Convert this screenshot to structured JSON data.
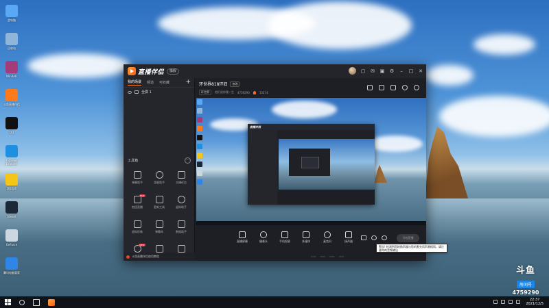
{
  "desktop": {
    "icons": [
      {
        "label": "此电脑",
        "icon": "computer-icon",
        "color": "#5aa7f5"
      },
      {
        "label": "回收站",
        "icon": "recycle-bin-icon",
        "color": "#8fb6d9"
      },
      {
        "label": "WinRAR",
        "icon": "winrar-icon",
        "color": "#a23c7a"
      },
      {
        "label": "斗鱼直播伴侣",
        "icon": "douyu-icon",
        "color": "#ff7a1a"
      },
      {
        "label": "QQ",
        "icon": "qq-icon",
        "color": "#111111"
      },
      {
        "label": "Internet Explorer",
        "icon": "ie-icon",
        "color": "#1f8fe0"
      },
      {
        "label": "QQ游戏",
        "icon": "qq-game-icon",
        "color": "#f5c518"
      },
      {
        "label": "Steam",
        "icon": "steam-icon",
        "color": "#1b2838"
      },
      {
        "label": "GeForce",
        "icon": "settings-icon",
        "color": "#ccd7e0"
      },
      {
        "label": "腾讯电脑管家",
        "icon": "shield-icon",
        "color": "#2f86e6"
      }
    ]
  },
  "app": {
    "brand": "直播伴侣",
    "tag": "旗舰",
    "title_buttons": [
      "record-icon",
      "message-icon",
      "gift-icon",
      "settings-icon",
      "minimize-icon",
      "maximize-icon",
      "close-icon"
    ],
    "left": {
      "tabs": [
        "我的场景",
        "频道",
        "可收藏"
      ],
      "add": "+",
      "scene_name": "全屏 1",
      "tools_title": "工具箱",
      "tools": [
        {
          "label": "弹幕助手",
          "icon": "chat-bubble-icon"
        },
        {
          "label": "游客助手",
          "icon": "user-icon"
        },
        {
          "label": "主播任务",
          "icon": "clipboard-icon"
        },
        {
          "label": "抱团直播",
          "icon": "team-icon",
          "badge": "HOT"
        },
        {
          "label": "更新工具",
          "icon": "download-icon"
        },
        {
          "label": "虚拟助手",
          "icon": "robot-icon"
        },
        {
          "label": "虚拟形象",
          "icon": "avatar-icon"
        },
        {
          "label": "弹幕库",
          "icon": "calendar-icon"
        },
        {
          "label": "数据助手",
          "icon": "chart-icon"
        },
        {
          "label": "商品橱窗",
          "icon": "shop-icon",
          "badge": "NEW"
        },
        {
          "label": "下载中心",
          "icon": "download-icon"
        },
        {
          "label": "更多",
          "icon": "more-icon"
        }
      ],
      "bottom_tip": "斗鱼直播伴侣使用教程"
    },
    "room": {
      "title": "环世界818环旧",
      "edit_label": "修改",
      "category": "环世界",
      "notice": "他们说你我一生",
      "room_number": "4759290",
      "hot_value": "13274"
    },
    "bottom_tools": [
      {
        "label": "直播屏幕",
        "icon": "screen-icon"
      },
      {
        "label": "摄像头",
        "icon": "camera-icon"
      },
      {
        "label": "手机投屏",
        "icon": "phone-icon"
      },
      {
        "label": "多媒体",
        "icon": "media-icon"
      },
      {
        "label": "麦克风",
        "icon": "microphone-icon"
      },
      {
        "label": "扬声器",
        "icon": "speaker-icon"
      }
    ],
    "live_button": "开始直播",
    "tooltip": "警告!  检测到您的扬声器与您的麦克风声源相同，请注意你的音频输出"
  },
  "watermark": {
    "logo": "斗鱼",
    "room_label": "房间号",
    "room_number": "4759290"
  },
  "taskbar": {
    "time": "22:37",
    "date": "2021/12/5"
  },
  "colors": {
    "accent": "#ff7a1a",
    "app_bg": "#1d1f24",
    "douyu_blue": "#1a86e8"
  }
}
